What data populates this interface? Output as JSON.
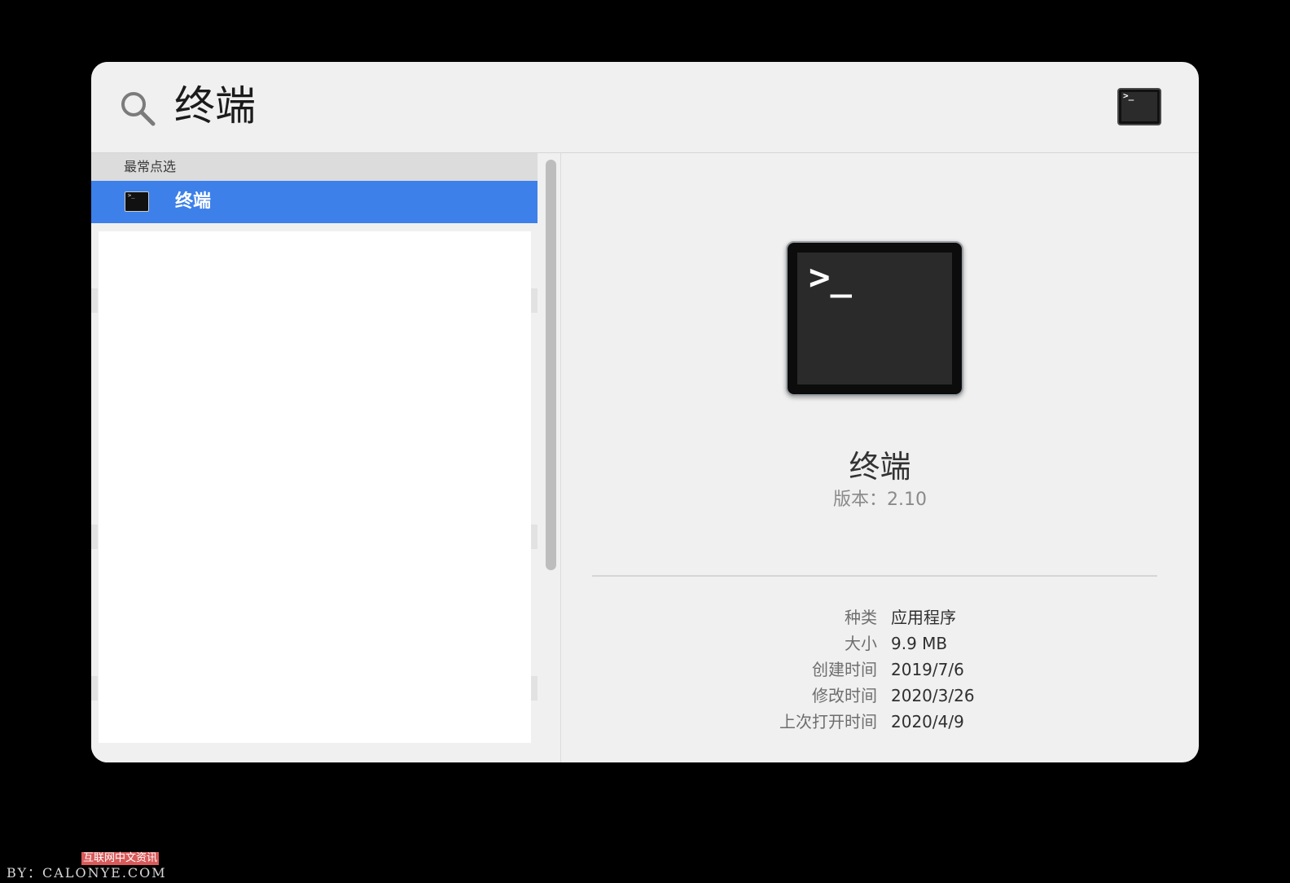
{
  "search": {
    "query": "终端"
  },
  "results": {
    "section_header": "最常点选",
    "selected_item": {
      "label": "终端",
      "icon": "terminal-icon"
    }
  },
  "preview": {
    "app_name": "终端",
    "version_text": "版本：2.10",
    "icon": "terminal-icon",
    "prompt_glyph": ">_",
    "info": [
      {
        "label": "种类",
        "value": "应用程序"
      },
      {
        "label": "大小",
        "value": "9.9 MB"
      },
      {
        "label": "创建时间",
        "value": "2019/7/6"
      },
      {
        "label": "修改时间",
        "value": "2020/3/26"
      },
      {
        "label": "上次打开时间",
        "value": "2020/4/9"
      }
    ]
  },
  "watermark": {
    "badge": "互联网中文资讯",
    "text": "BY：CALONYE.COM"
  },
  "colors": {
    "selection": "#3d80ea",
    "window_bg": "#f0f0f0",
    "backdrop": "#000000"
  }
}
